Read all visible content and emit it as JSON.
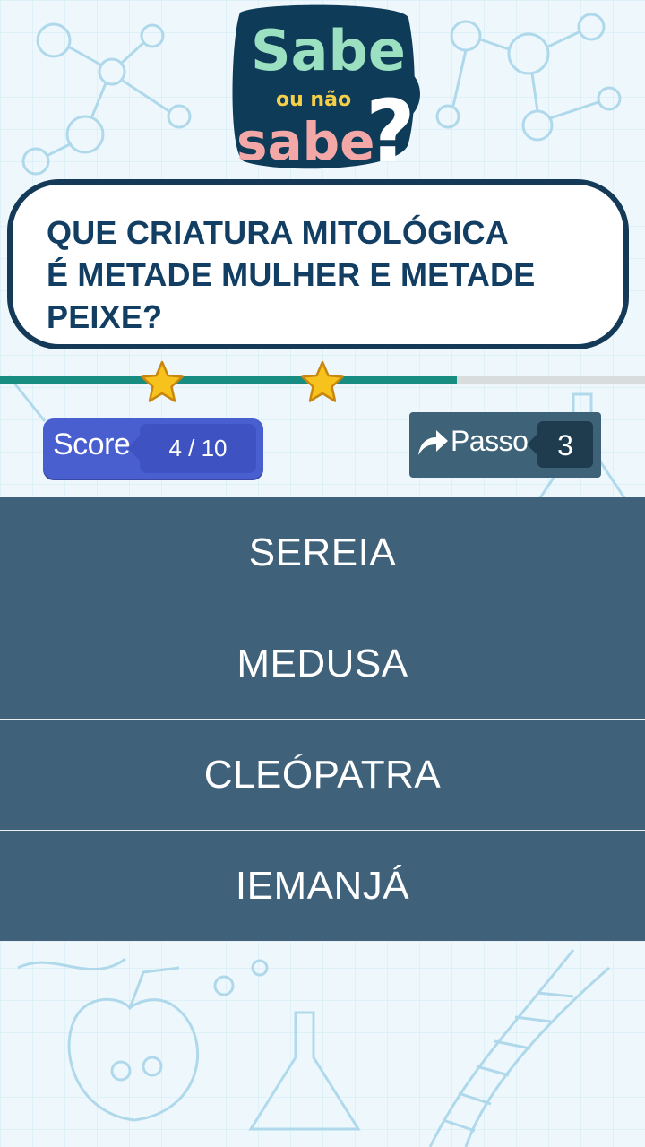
{
  "logo": {
    "line1": "Sabe",
    "line2": "ou não",
    "line3": "sabe",
    "mark": "?"
  },
  "question": {
    "text": "QUE CRIATURA  MITOLÓGICA\nÉ METADE MULHER E METADE\nPEIXE?"
  },
  "progress": {
    "fraction": 0.708,
    "stars_earned": 2,
    "fill_color": "#178c80",
    "track_color": "#d9dcdd"
  },
  "score": {
    "label": "Score",
    "value": "4 / 10",
    "color": "#4a5fcf"
  },
  "pass": {
    "icon": "forward-arrow-icon",
    "label": "Passo",
    "count": "3",
    "color": "#3e6379"
  },
  "answers": [
    {
      "label": "SEREIA"
    },
    {
      "label": "MEDUSA"
    },
    {
      "label": "CLEÓPATRA"
    },
    {
      "label": "IEMANJÁ"
    }
  ],
  "colors": {
    "answer_bg": "#3f6179",
    "question_border": "#143a58",
    "question_text": "#123e63"
  }
}
